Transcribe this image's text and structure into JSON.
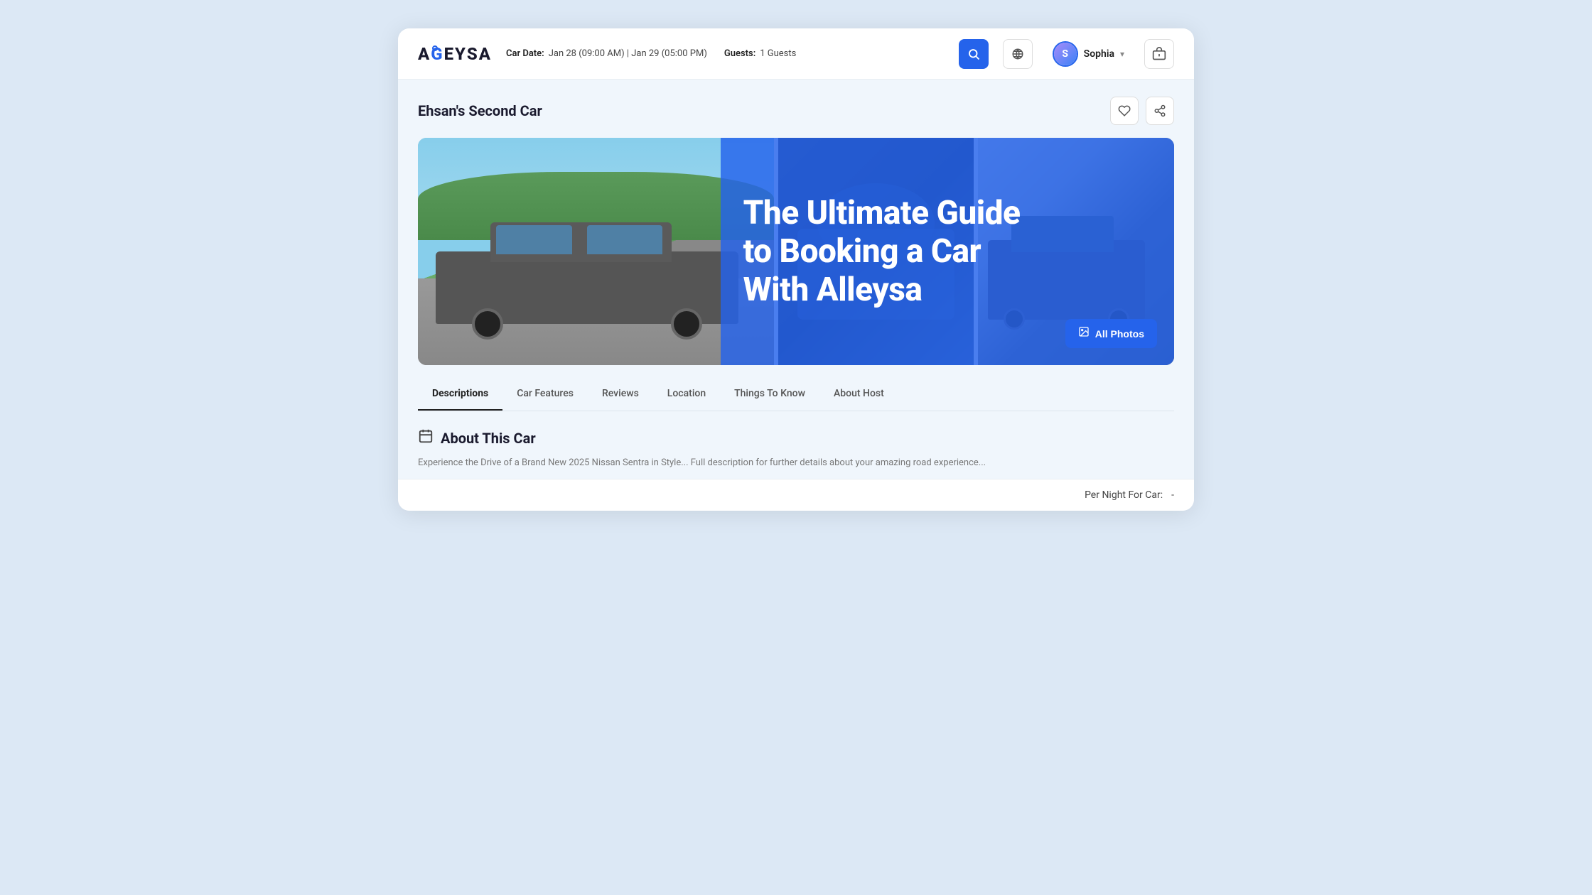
{
  "logo": {
    "text_before": "A",
    "text_accent": "G",
    "text_after": "EYSA",
    "full": "AGEYSA"
  },
  "header": {
    "car_date_label": "Car Date:",
    "car_date_value": "Jan 28 (09:00 AM) | Jan 29 (05:00 PM)",
    "guests_label": "Guests:",
    "guests_value": "1 Guests",
    "search_icon": "🔍",
    "globe_icon": "🌐",
    "user_name": "Sophia",
    "chevron_icon": "▾",
    "cart_icon": "🛒"
  },
  "car": {
    "title": "Ehsan's Second Car",
    "heart_icon": "♡",
    "share_icon": "⬡"
  },
  "promo": {
    "line1": "The Ultimate Guide",
    "line2": "to Booking a Car",
    "line3": "With Alleysa"
  },
  "all_photos": {
    "label": "All Photos",
    "icon": "🖼"
  },
  "tabs": [
    {
      "id": "descriptions",
      "label": "Descriptions",
      "active": true
    },
    {
      "id": "car-features",
      "label": "Car Features",
      "active": false
    },
    {
      "id": "reviews",
      "label": "Reviews",
      "active": false
    },
    {
      "id": "location",
      "label": "Location",
      "active": false
    },
    {
      "id": "things-to-know",
      "label": "Things To Know",
      "active": false
    },
    {
      "id": "about-host",
      "label": "About Host",
      "active": false
    }
  ],
  "about": {
    "icon": "🪪",
    "title": "About This Car",
    "description": "Experience the Drive of a Brand New 2025 Nissan Sentra in Style... Full description for further details about your amazing road experience..."
  },
  "bottom_bar": {
    "label": "Per Night For Car:",
    "separator": "-"
  }
}
